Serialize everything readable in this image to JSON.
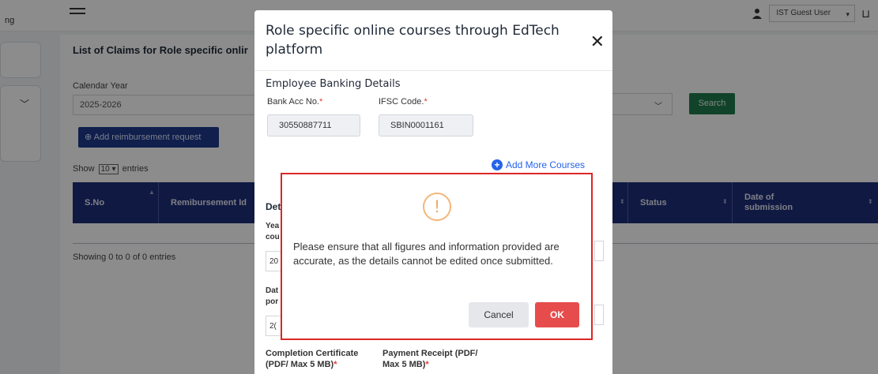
{
  "header": {
    "brand_fragment": "ng",
    "user_name": "IST Guest User"
  },
  "page": {
    "list_title": "List of Claims for Role specific onlir",
    "calendar_year_label": "Calendar Year",
    "calendar_year_value": "2025-2026",
    "search_label": "Search",
    "add_request_label": "Add reimbursement request",
    "show_label": "Show",
    "entries_select": "10",
    "entries_label": "entries",
    "showing_text": "Showing 0 to 0 of 0 entries",
    "table": {
      "columns": [
        "S.No",
        "Remibursement Id",
        "Status",
        "Date of submission"
      ]
    }
  },
  "modal": {
    "title": "Role specific online courses through EdTech platform",
    "bank_heading": "Employee Banking Details",
    "bank_acc_label": "Bank Acc No.",
    "bank_acc_value": "30550887711",
    "ifsc_label": "IFSC Code.",
    "ifsc_value": "SBIN0001161",
    "add_more_label": "Add More Courses",
    "details_fragment": "Det",
    "year_fragment": "Yea",
    "course_fragment": "cou",
    "year_value_fragment": "20",
    "date_fragment": "Dat",
    "portal_fragment": "por",
    "date_value_fragment": "2(",
    "completion_label_line1": "Completion Certificate",
    "completion_label_line2": "(PDF/ Max 5 MB)",
    "payment_label_line1": "Payment Receipt (PDF/",
    "payment_label_line2": "Max 5 MB)",
    "required_mark": "*"
  },
  "confirm": {
    "icon": "exclamation-icon",
    "message": "Please ensure that all figures and information provided are accurate, as the details cannot be edited once submitted.",
    "cancel_label": "Cancel",
    "ok_label": "OK"
  },
  "colors": {
    "table_header": "#1e2f78",
    "search_button": "#1f7a4d",
    "add_button": "#1e3a8a",
    "ok_button": "#e74c4c",
    "highlight_border": "#dc2626",
    "link_blue": "#2563eb",
    "warning_orange": "#f4a55c"
  }
}
